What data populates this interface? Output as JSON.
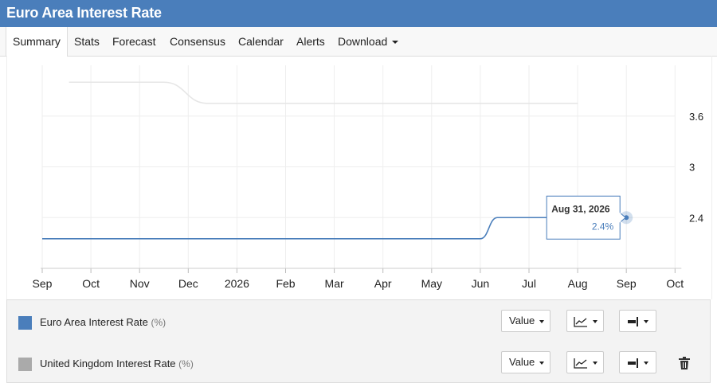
{
  "header": {
    "title": "Euro Area Interest Rate"
  },
  "tabs": [
    {
      "label": "Summary"
    },
    {
      "label": "Stats"
    },
    {
      "label": "Forecast"
    },
    {
      "label": "Consensus"
    },
    {
      "label": "Calendar"
    },
    {
      "label": "Alerts"
    },
    {
      "label": "Download"
    }
  ],
  "chart_data": {
    "type": "line",
    "x_labels": [
      "Sep",
      "Oct",
      "Nov",
      "Dec",
      "2026",
      "Feb",
      "Mar",
      "Apr",
      "May",
      "Jun",
      "Jul",
      "Aug",
      "Sep",
      "Oct"
    ],
    "y_ticks": [
      2.4,
      3,
      3.6
    ],
    "ylim": [
      1.8,
      4.2
    ],
    "grid": true,
    "series": [
      {
        "name": "Euro Area Interest Rate",
        "color": "#4a7ebb",
        "points": [
          [
            0,
            2.15
          ],
          [
            9.0,
            2.15
          ],
          [
            9.35,
            2.4
          ],
          [
            12.0,
            2.4
          ]
        ]
      },
      {
        "name": "United Kingdom Interest Rate",
        "color": "#e6e6e6",
        "points": [
          [
            0.55,
            4.0
          ],
          [
            2.5,
            4.0
          ],
          [
            3.4,
            3.75
          ],
          [
            11.0,
            3.75
          ]
        ]
      }
    ],
    "tooltip": {
      "date": "Aug 31, 2026",
      "value": "2.4%"
    }
  },
  "legend": {
    "items": [
      {
        "name": "Euro Area Interest Rate",
        "unit": "(%)",
        "color": "#4a7ebb",
        "value_label": "Value",
        "has_delete": false
      },
      {
        "name": "United Kingdom Interest Rate",
        "unit": "(%)",
        "color": "#aaaaaa",
        "value_label": "Value",
        "has_delete": true
      }
    ]
  }
}
